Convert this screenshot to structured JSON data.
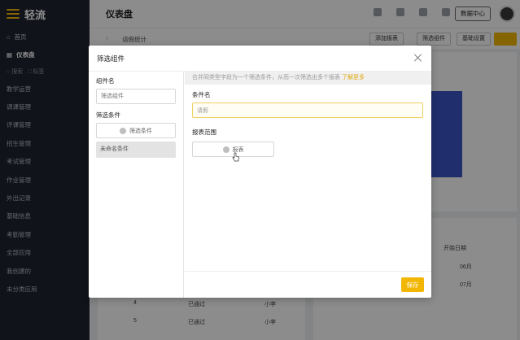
{
  "app": {
    "name": "轻流"
  },
  "sidebar": {
    "top_items": [
      {
        "label": "首页",
        "icon": "home-icon"
      },
      {
        "label": "仪表盘",
        "icon": "dashboard-icon"
      }
    ],
    "search_items": [
      {
        "label": "搜索",
        "icon": "search-icon"
      },
      {
        "label": "标签",
        "icon": "tag-icon"
      }
    ],
    "menu_items": [
      "教学运营",
      "调课管理",
      "评课管理",
      "招生管理",
      "考试管理",
      "作业管理",
      "外出记录",
      "基础信息",
      "考勤管理",
      "全部应用",
      "我创建的",
      "未分类应用"
    ]
  },
  "header": {
    "title": "仪表盘",
    "data_center_label": "数据中心",
    "icons": [
      "gear-icon",
      "document-icon",
      "puzzle-icon",
      "bell-icon",
      "help-icon"
    ]
  },
  "background": {
    "page_title": "请假统计",
    "add_report_label": "添加报表",
    "filter_component_label": "筛选组件",
    "basic_settings_label": "基础设置",
    "table_header_start_date": "开始日期",
    "dates": [
      "06月",
      "07月"
    ],
    "rows": [
      {
        "index": "4",
        "status": "已通过",
        "user": "小李"
      },
      {
        "index": "5",
        "status": "已通过",
        "user": "小李"
      }
    ],
    "bar_color": "#3b55c6"
  },
  "modal": {
    "title": "筛选组件",
    "left": {
      "component_name_label": "组件名",
      "component_name_placeholder": "筛选组件",
      "filter_conditions_label": "筛选条件",
      "filter_button_label": "筛选条件",
      "conditions": [
        "未命名条件"
      ]
    },
    "right": {
      "tip_text": "合并同类型字段为一个筛选条件，从而一次筛选出多个报表",
      "tip_link": "了解更多",
      "condition_name_label": "条件名",
      "condition_name_value": "请假",
      "report_scope_label": "报表范围",
      "report_button_label": "报表"
    },
    "save_label": "保存"
  },
  "colors": {
    "accent": "#f2b705",
    "sidebar_bg": "#1f2430"
  }
}
